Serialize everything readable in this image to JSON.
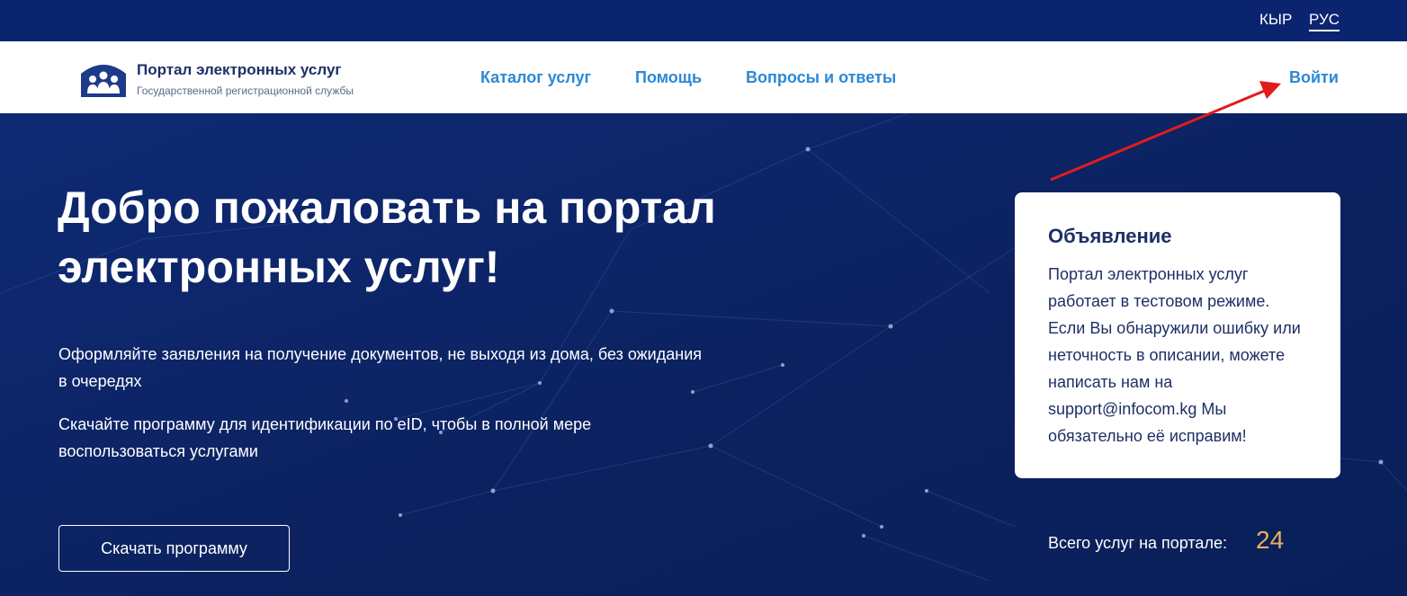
{
  "colors": {
    "topbar": "#0b2470",
    "hero": "#0d2566",
    "link": "#2d88d4",
    "brand_text": "#1e2f66",
    "count_accent": "#e7b15e",
    "annotation_arrow": "#e31b1b"
  },
  "topbar": {
    "lang_kyr": "КЫР",
    "lang_rus": "РУС"
  },
  "header": {
    "logo_title": "Портал электронных услуг",
    "logo_subtitle": "Государственной регистрационной службы",
    "nav": {
      "catalog": "Каталог услуг",
      "help": "Помощь",
      "faq": "Вопросы и ответы"
    },
    "login": "Войти"
  },
  "hero": {
    "title": "Добро пожаловать на портал электронных услуг!",
    "p1": "Оформляйте заявления на получение документов, не выходя из дома, без ожидания в очередях",
    "p2": "Скачайте программу для идентификации по eID, чтобы в полной мере воспользоваться услугами",
    "download_button": "Скачать программу"
  },
  "notice": {
    "title": "Объявление",
    "text": "Портал электронных услуг работает в тестовом режиме. Если Вы обнаружили ошибку или неточность в описании, можете написать нам на support@infocom.kg Мы обязательно её исправим!"
  },
  "stats": {
    "label": "Всего услуг на портале:",
    "count": "24"
  }
}
